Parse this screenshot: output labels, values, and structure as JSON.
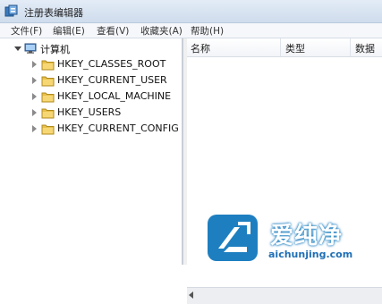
{
  "window": {
    "title": "注册表编辑器"
  },
  "menu": [
    "文件(F)",
    "编辑(E)",
    "查看(V)",
    "收藏夹(A)",
    "帮助(H)"
  ],
  "tree": {
    "root": "计算机",
    "keys": [
      "HKEY_CLASSES_ROOT",
      "HKEY_CURRENT_USER",
      "HKEY_LOCAL_MACHINE",
      "HKEY_USERS",
      "HKEY_CURRENT_CONFIG"
    ]
  },
  "list": {
    "columns": [
      "名称",
      "类型",
      "数据"
    ]
  },
  "watermark": {
    "text": "爱纯净",
    "url": "aichunjing.com"
  },
  "colors": {
    "folder": "#e8c04a",
    "accent": "#1e7fc0",
    "titlebar": "#dbe6f4"
  }
}
